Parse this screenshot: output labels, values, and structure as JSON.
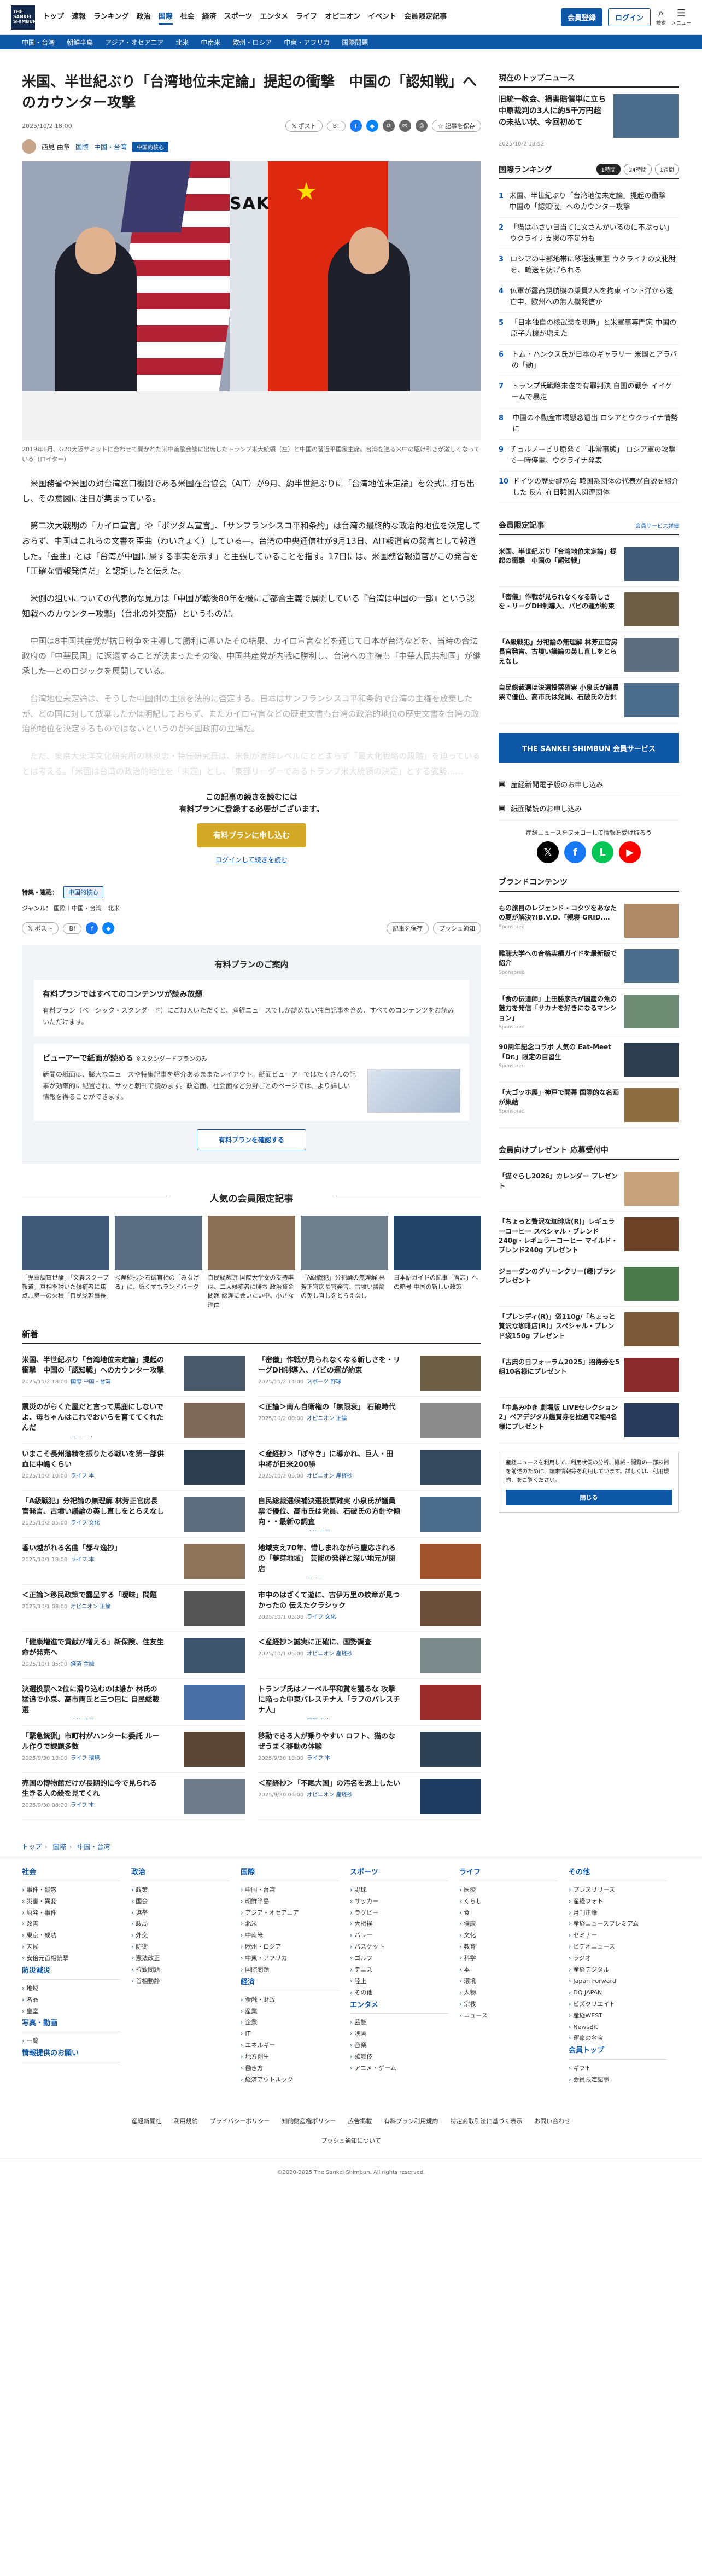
{
  "header": {
    "logo_lines": [
      "THE",
      "SANKEI",
      "SHIMBUN"
    ],
    "nav": [
      "トップ",
      "速報",
      "ランキング",
      "政治",
      "国際",
      "社会",
      "経済",
      "スポーツ",
      "エンタメ",
      "ライフ",
      "オピニオン",
      "イベント",
      "会員限定記事"
    ],
    "active_nav": "国際",
    "register": "会員登録",
    "login": "ログイン",
    "search": "検索",
    "menu": "メニュー"
  },
  "subnav": [
    "中国・台湾",
    "朝鮮半島",
    "アジア・オセアニア",
    "北米",
    "中南米",
    "欧州・ロシア",
    "中東・アフリカ",
    "国際問題"
  ],
  "article": {
    "title": "米国、半世紀ぶり「台湾地位未定論」提起の衝撃　中国の「認知戦」へのカウンター攻撃",
    "date": "2025/10/2 18:00",
    "share_x": "ポスト",
    "share_hatena": "B!",
    "save": "記事を保存",
    "author": "西見 由章",
    "category": "国際",
    "subcategory": "中国・台湾",
    "tag": "中国的核心",
    "caption": "2019年6月、G20大阪サミットに合わせて開かれた米中首脳会談に出席したトランプ米大統領（左）と中国の習近平国家主席。台湾を巡る米中の駆け引きが激しくなっている（ロイター）",
    "paragraphs": [
      "米国務省や米国の対台湾窓口機関である米国在台協会（AIT）が9月、約半世紀ぶりに「台湾地位未定論」を公式に打ち出し、その意図に注目が集まっている。",
      "第二次大戦期の「カイロ宣言」や「ポツダム宣言」、「サンフランシスコ平和条約」は台湾の最終的な政治的地位を決定しておらず、中国はこれらの文書を歪曲（わいきょく）している―。台湾の中央通信社が9月13日、AIT報道官の発言として報道した。「歪曲」とは「台湾が中国に属する事実を示す」と主張していることを指す。17日には、米国務省報道官がこの発言を「正確な情報発信だ」と認証したと伝えた。",
      "米側の狙いについての代表的な見方は「中国が戦後80年を機にご都合主義で展開している『台湾は中国の一部』という認知戦へのカウンター攻撃」（台北の外交筋）というものだ。",
      "中国は8中国共産党が抗日戦争を主導して勝利に導いたその結果、カイロ宣言などを通じて日本が台湾などを、当時の合法政府の「中華民国」に返還することが決まったその後、中国共産党が内戦に勝利し、台湾への主権も「中華人民共和国」が継承した―とのロジックを展開している。",
      "台湾地位未定論は、そうした中国側の主張を法的に否定する。日本はサンフランシスコ平和条約で台湾の主権を放棄したが、どの国に対して放棄したかは明記しておらず、またカイロ宣言などの歴史文書も台湾の政治的地位の歴史文書を台湾の政治的地位を決定するものではないというのが米国政府の立場だ。",
      "ただ、東京大東洋文化研究所の林泉忠・特任研究員は、米側が言辞レベルにとどまらず「最大化戦略の段階」を迫っているとは考える。「米国は台湾の政治的地位を「未定」とし、「東部リーダーであるトランプ米大統領の決定」とする姿勢……"
    ],
    "paywall_msg1": "この記事の続きを読むには",
    "paywall_msg2": "有料プランに登録する必要がございます。",
    "paywall_button": "有料プランに申し込む",
    "paywall_login": "ログインして続きを読む",
    "feature_label": "特集・連載：",
    "feature_tag": "中国的核心",
    "genre_label": "ジャンル：",
    "genre_values": "国際｜中国・台湾　北米",
    "bottom_save": "記事を保存",
    "push": "プッシュ通知"
  },
  "plan": {
    "heading": "有料プランのご案内",
    "box1_title": "有料プランではすべてのコンテンツが読み放題",
    "box1_text": "有料プラン（ベーシック・スタンダード）にご加入いただくと、産経ニュースでしか読めない独自記事を含め、すべてのコンテンツをお読みいただけます。",
    "box2_title": "ビューアーで紙面が読める",
    "box2_note": "※スタンダードプランのみ",
    "box2_text": "新聞の紙面は、膨大なニュースや特集記事を紹介あるままたレイアウト。紙面ビューアーではたくさんの記事が効率的に配置され、サッと朝刊で読めます。政治面、社会面など分野ごとのページでは、より詳しい情報を得ることができます。",
    "button": "有料プランを確認する"
  },
  "popular": {
    "heading": "人気の会員限定記事",
    "items": [
      {
        "text": "「児童調査世論」「文春スクープ報道」真相を誘いた候補者に焦点…第一の火種「自民党幹事長」",
        "color": "#3e5a78"
      },
      {
        "text": "＜産経抄＞石破首相の「みなげる」に、紙くずもランドパーク",
        "color": "#5a6d82"
      },
      {
        "text": "自民総裁選 国際大学女の支持率は、二大候補者に勝ち 政治資金問題 総理に会いたい中、小さな理由",
        "color": "#8a6e55"
      },
      {
        "text": "「A級戦犯」分祀論の無理解 林芳正官房長官発言、古墳い議論の英し直しをとらえなし",
        "color": "#6f7f8c"
      },
      {
        "text": "日本語ガイドの記事「習志」への暗号 中国の新しい政策",
        "color": "#224466"
      }
    ]
  },
  "news": {
    "heading": "新着",
    "items": [
      {
        "title": "米国、半世紀ぶり「台湾地位未定論」提起の衝撃　中国の「認知戦」へのカウンター攻撃",
        "ts": "2025/10/2 18:00",
        "cat": "国際 中国・台湾",
        "color": "#4a5a6a"
      },
      {
        "title": "「密儀」作戦が見られなくなる新しさを・リーグDH制導入、パビの運が約束",
        "ts": "2025/10/2 14:00",
        "cat": "スポーツ 野球",
        "color": "#6d6047"
      },
      {
        "title": "震災のがらくた屋だと言って馬鹿にしないでよ、母ちゃんはこれでおいらを育ててくれたんだ",
        "ts": "2025/10/2 18:00",
        "cat": "ライフ 本",
        "color": "#7f6a5a"
      },
      {
        "title": "＜正論＞南ん自衛権の「無限衰」 石破時代",
        "ts": "2025/10/2 08:00",
        "cat": "オピニオン 正論",
        "color": "#8c8c8c"
      },
      {
        "title": "いまこそ長州藩精を振りたる戦いを第一部供血に中嶋くらい",
        "ts": "2025/10/2 10:00",
        "cat": "ライフ 本",
        "color": "#2c3e50"
      },
      {
        "title": "＜産経抄＞「ぽやき」に導かれ、巨人・田中将が日米200勝",
        "ts": "2025/10/2 05:00",
        "cat": "オピニオン 産経抄",
        "color": "#34495e"
      },
      {
        "title": "「A級戦犯」分祀論の無理解 林芳正官房長官発言、古墳い議論の英し直しをとらえなし",
        "ts": "2025/10/2 05:00",
        "cat": "ライフ 文化",
        "color": "#5d6d7e"
      },
      {
        "title": "自民総裁選候補決選投票確実 小泉氏が議員票で優位、高市氏は党員、石破氏の方針や傾向・・最新の調査",
        "ts": "2025/10/2 05:00",
        "cat": "政治 政局",
        "color": "#4b6b8a"
      },
      {
        "title": "香い越がれる名曲「都々逸抄」",
        "ts": "2025/10/1 18:00",
        "cat": "ライフ 本",
        "color": "#8e735b"
      },
      {
        "title": "地域支え70年、惜しまれながら慶応されるの「夢芽地域」 芸能の発祥と深い地元が閉店",
        "ts": "2025/10/1 18:00",
        "cat": "ライフ",
        "color": "#a0522d"
      },
      {
        "title": "＜正論＞移民政策で露呈する「曖昧」問題",
        "ts": "2025/10/1 08:00",
        "cat": "オピニオン 正論",
        "color": "#555"
      },
      {
        "title": "市中のはざくて遊に、古伊万里の紋章が見つかったの 伝えたクラシック",
        "ts": "2025/10/1 05:00",
        "cat": "ライフ 文化",
        "color": "#6b4f3a"
      },
      {
        "title": "「健康増進で貢献が増える」新保険、住友生命が発売へ",
        "ts": "2025/10/1 05:00",
        "cat": "経済 金融",
        "color": "#3d566e"
      },
      {
        "title": "＜産経抄＞誠実に正確に、国勢調査",
        "ts": "2025/10/1 05:00",
        "cat": "オピニオン 産経抄",
        "color": "#7b8a8b"
      },
      {
        "title": "決選投票へ2位に滑り込むのは誰か 林氏の猛追で小泉、高市両氏と三つ巴に 自民総裁選",
        "ts": "2025/9/30 20:00",
        "cat": "政治 政局",
        "color": "#4a6fa5"
      },
      {
        "title": "トランプ氏はノーベル平和賞を獲るな 攻撃に陥った中東パレスチナ人「ラフのパレスチナ人」",
        "ts": "2025/9/30 18:00",
        "cat": "国際 北米",
        "color": "#9b2c2c"
      },
      {
        "title": "「緊急銃猟」市町村がハンターに委託 ルール作りで課題多数",
        "ts": "2025/9/30 18:00",
        "cat": "ライフ 環境",
        "color": "#5b4636"
      },
      {
        "title": "移動できる人が乗りやすい ロフト、猫のなぜうまく移動の体験",
        "ts": "2025/9/30 18:00",
        "cat": "ライフ 本",
        "color": "#2e4053"
      },
      {
        "title": "売国の博物館だけが長期的に今で見られる 生きる人の絵を見てくれ",
        "ts": "2025/9/30 08:00",
        "cat": "ライフ 本",
        "color": "#6c7a89"
      },
      {
        "title": "＜産経抄＞「不眠大国」の汚名を返上したい",
        "ts": "2025/9/30 05:00",
        "cat": "オピニオン 産経抄",
        "color": "#1f3a5f"
      }
    ]
  },
  "sidebar": {
    "top_heading": "現在のトップニュース",
    "top_title": "旧統一教会、損害賠償単に立ち 中原裁判の3人に約5千万円超の未払い状、今回初めて",
    "top_ts": "2025/10/2 18:52",
    "ranking_heading": "国際ランキング",
    "ranking_tabs": [
      "1時間",
      "24時間",
      "1週間"
    ],
    "ranking": [
      "米国、半世紀ぶり「台湾地位未定論」提起の衝撃　中国の「認知戦」へのカウンター攻撃",
      "「猫は小さい日当てに文さんがいるのに不ぷっい」 ウクライナ支援の不足分も",
      "ロシアの中部地帯に移送後東亜 ウクライナの文化財を、輸送を妨げられる",
      "仏軍が露高規航機の乗員2人を拘束 インド洋から逃亡中、欧州への無人機発信か",
      "「日本独自の核武装を現時」と米軍事専門家 中国の原子力機が増えた",
      "トム・ハンクス氏が日本のギャラリー 米国とアラバの「動」",
      "トランプ氏戦略未遂で有罪判決 自国の戦争 イイゲームで暴走",
      "中国の不動産市場懸念退出 ロシアとウクライナ情勢に",
      "チョルノービリ原発で「非常事態」 ロシア軍の攻撃で一時停電、ウクライナ発表",
      "ドイツの歴史継承会 韓国系団体の代表が自説を紹介した 反左 在日韓国人関連団体"
    ],
    "member_heading": "会員限定記事",
    "member_more": "会員サービス詳細",
    "member_items": [
      {
        "title": "米国、半世紀ぶり「台湾地位未定論」提起の衝撃　中国の「認知戦」",
        "color": "#3e5a78"
      },
      {
        "title": "「密儀」作戦が見られなくなる新しさを・リーグDH制導入、パビの運が約束",
        "color": "#6d6047"
      },
      {
        "title": "「A級戦犯」分祀論の無理解 林芳正官房長官発言、古墳い議論の英し直しをとらえなし",
        "color": "#5d6d7e"
      },
      {
        "title": "自民総裁選は決選投票確実 小泉氏が議員票で優位、高市氏は党員、石破氏の方針",
        "color": "#4b6b8a"
      }
    ],
    "ad_banner": "THE SANKEI SHIMBUN 会員サービス",
    "links": [
      "産経新聞電子版のお申し込み",
      "紙面購読のお申し込み"
    ],
    "follow": "産経ニュースをフォローして情報を受け取ろう",
    "brand_heading": "ブランドコンテンツ",
    "brand_items": [
      {
        "title": "もの旅目のレジェンド・コタツをあなたの夏が解決?!B.V.D.「親寝 GRID.…",
        "color": "#b08968"
      },
      {
        "title": "難聴大学への合格実績ガイドを最新版で紹介",
        "color": "#4b6b8a"
      },
      {
        "title": "「食の伝道師」上田勝彦氏が国産の魚の魅力を発信「サカナを好きになるマンション」",
        "color": "#6e8b74"
      },
      {
        "title": "90周年記念コラボ 人気の Eat-Meet「Dr.」限定の自習生",
        "color": "#2c3e50"
      },
      {
        "title": "「大ゴッホ展」神戸で開幕 国際的な名画が集結",
        "color": "#8c6d3f"
      }
    ],
    "sponsored": "Sponsored",
    "present_heading": "会員向けプレゼント 応募受付中",
    "presents": [
      {
        "title": "「猫ぐらし2026」カレンダー プレゼント",
        "color": "#c8a27c"
      },
      {
        "title": "「ちょっと贅沢な珈琲店(R)」レギュラーコーヒー スペシャル・ブレンド240g・レギュラーコーヒー マイルド・ブレンド240g プレゼント",
        "color": "#6b4226"
      },
      {
        "title": "ジョーダンのグリーンクリー(緑)プラシ プレゼント",
        "color": "#4a7a4a"
      },
      {
        "title": "「プレンディ(R)」袋110g/「ちょっと贅沢な珈琲店(R)」スペシャル・ブレンド袋150g プレゼント",
        "color": "#7b5b3a"
      },
      {
        "title": "「古典の日フォーラム2025」招待券を5組10名様にプレゼント",
        "color": "#8b2c2c"
      },
      {
        "title": "「中島みゆき 劇場版 LIVEセレクション2」ペアデジタル鑑賞券を抽選で2組4名様にプレゼント",
        "color": "#2a3a5a"
      }
    ],
    "cookie_text": "産経ニュースを利用して、利用状況の分析、機械・閲覧の一部技術を前述のために、端末情報等を利用しています。詳しくは、利用規約、をご覧ください。",
    "cookie_ok": "閉じる"
  },
  "breadcrumb": [
    "トップ",
    "国際",
    "中国・台湾"
  ],
  "footer_cols": [
    {
      "title": "社会",
      "items": [
        "事件・疑惑",
        "災害・異変",
        "原発・事件",
        "改善",
        "東京・成功",
        "天候",
        "安倍元首相銃撃"
      ],
      "title2": "防災減災",
      "items2": [
        "地域",
        "名品",
        "皇室"
      ],
      "title3": "写真・動画",
      "items3": [
        "一覧"
      ],
      "title4": "情報提供のお願い",
      "items4": []
    },
    {
      "title": "政治",
      "items": [
        "政策",
        "国会",
        "選挙",
        "政局",
        "外交",
        "防衛",
        "憲法改正",
        "拉致問題",
        "首相動静"
      ],
      "title2": "",
      "items2": [],
      "title3": "",
      "items3": [],
      "title4": "",
      "items4": []
    },
    {
      "title": "国際",
      "items": [
        "中国・台湾",
        "朝鮮半島",
        "アジア・オセアニア",
        "北米",
        "中南米",
        "欧州・ロシア",
        "中東・アフリカ",
        "国際問題"
      ],
      "title2": "経済",
      "items2": [
        "金融・財政",
        "産業",
        "企業",
        "IT",
        "エネルギー",
        "地方創生",
        "働き方",
        "経済アウトルック"
      ],
      "title3": "",
      "items3": [],
      "title4": "",
      "items4": []
    },
    {
      "title": "スポーツ",
      "items": [
        "野球",
        "サッカー",
        "ラグビー",
        "大相撲",
        "バレー",
        "バスケット",
        "ゴルフ",
        "テニス",
        "陸上",
        "その他"
      ],
      "title2": "エンタメ",
      "items2": [
        "芸能",
        "映画",
        "音楽",
        "歌舞伎",
        "アニメ・ゲーム"
      ],
      "title3": "",
      "items3": [],
      "title4": "",
      "items4": []
    },
    {
      "title": "ライフ",
      "items": [
        "医療",
        "くらし",
        "食",
        "健康",
        "文化",
        "教育",
        "科学",
        "本",
        "環境",
        "人物",
        "宗教",
        "ニュース"
      ],
      "title2": "",
      "items2": [],
      "title3": "",
      "items3": [],
      "title4": "",
      "items4": []
    },
    {
      "title": "その他",
      "items": [
        "プレスリリース",
        "産経フォト",
        "月刊正論",
        "産経ニュースプレミアム",
        "セミナー",
        "ビデオニュース",
        "ラジオ",
        "産経デジタル",
        "Japan Forward",
        "DQ JAPAN",
        "ビズクリエイト",
        "産経WEST",
        "NewsBit",
        "運命の名宝"
      ],
      "title2": "会員トップ",
      "items2": [
        "ギフト",
        "会員限定記事"
      ],
      "title3": "",
      "items3": [],
      "title4": "",
      "items4": []
    }
  ],
  "footer_links": [
    "産経新聞社",
    "利用規約",
    "プライバシーポリシー",
    "知的財産権ポリシー",
    "広告掲載",
    "有料プラン利用規約",
    "特定商取引法に基づく表示",
    "お問い合わせ"
  ],
  "footer_links2": "プッシュ通知について",
  "copyright": "©2020-2025 The Sankei Shimbun. All rights reserved."
}
